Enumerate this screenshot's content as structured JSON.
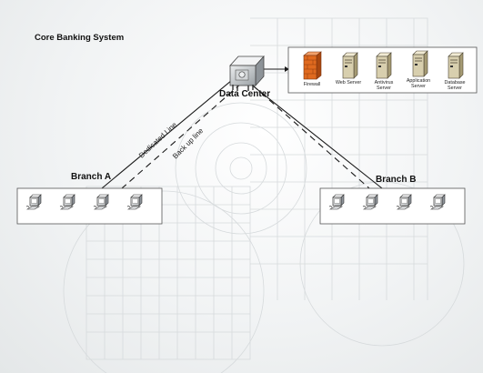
{
  "title": "Core Banking System",
  "data_center": {
    "label": "Data Center"
  },
  "links": {
    "primary": "Dedicated Line",
    "backup": "Back up line"
  },
  "branches": [
    {
      "label": "Branch A",
      "workstations": 4
    },
    {
      "label": "Branch B",
      "workstations": 4
    }
  ],
  "servers": [
    {
      "label": "Firewall",
      "icon": "firewall-icon",
      "color": "#e06a1f"
    },
    {
      "label": "Web Server",
      "icon": "server-icon",
      "color": "#d8cfae"
    },
    {
      "label": "Antivirus Server",
      "icon": "server-icon",
      "color": "#d8cfae"
    },
    {
      "label": "Application Server",
      "icon": "server-icon",
      "color": "#d8cfae"
    },
    {
      "label": "Database Server",
      "icon": "server-icon",
      "color": "#d8cfae"
    }
  ]
}
